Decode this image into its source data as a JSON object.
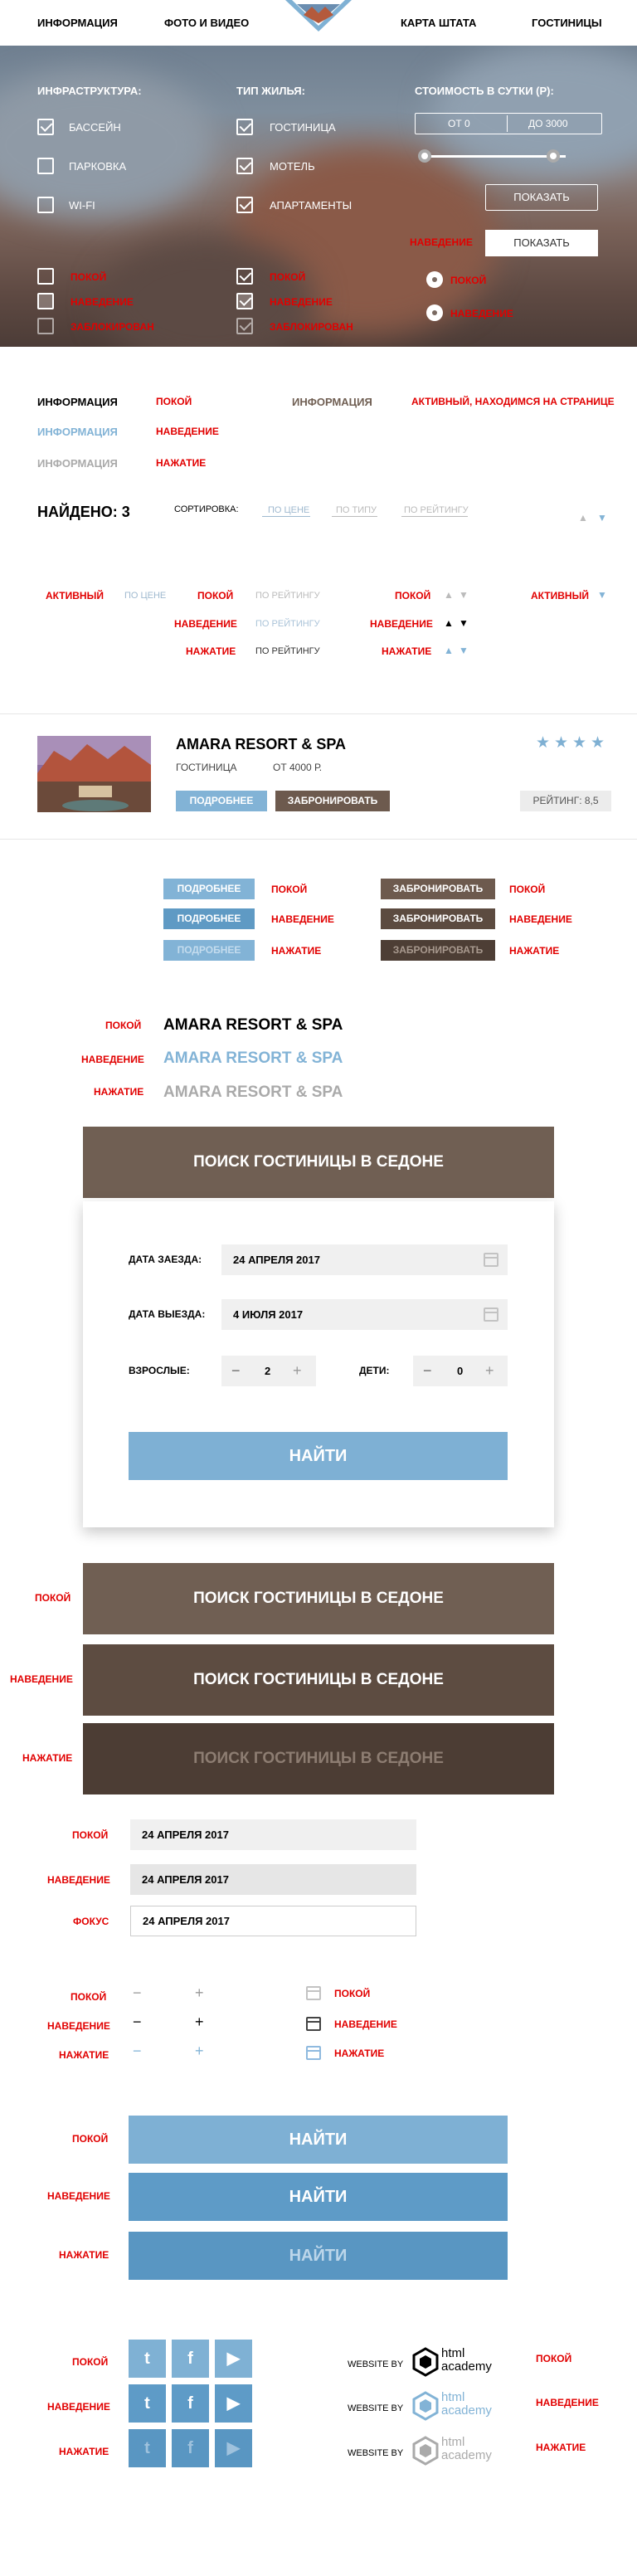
{
  "nav": {
    "info": "ИНФОРМАЦИЯ",
    "photo": "ФОТО И ВИДЕО",
    "map": "КАРТА ШТАТА",
    "hotels": "ГОСТИНИЦЫ",
    "logo": "SEDONA"
  },
  "hero": {
    "infra_title": "ИНФРАСТРУКТУРА:",
    "infra": [
      "БАССЕЙН",
      "ПАРКОВКА",
      "WI-FI"
    ],
    "type_title": "ТИП ЖИЛЬЯ:",
    "types": [
      "ГОСТИНИЦА",
      "МОТЕЛЬ",
      "АПАРТАМЕНТЫ"
    ],
    "price_title": "СТОИМОСТЬ В СУТКИ (Р):",
    "price_from": "ОТ 0",
    "price_to": "ДО 3000",
    "show": "ПОКАЗАТЬ",
    "hover": "НАВЕДЕНИЕ",
    "states": [
      "ПОКОЙ",
      "НАВЕДЕНИЕ",
      "ЗАБЛОКИРОВАН"
    ],
    "radio_states": [
      "ПОКОЙ",
      "НАВЕДЕНИЕ"
    ]
  },
  "states": {
    "rest": "ПОКОЙ",
    "hover": "НАВЕДЕНИЕ",
    "press": "НАЖАТИЕ",
    "active": "АКТИВНЫЙ",
    "focus": "ФОКУС",
    "active_page": "АКТИВНЫЙ, НАХОДИМСЯ НА СТРАНИЦЕ",
    "info": "ИНФОРМАЦИЯ"
  },
  "results": {
    "found": "НАЙДЕНО: 3",
    "sort_label": "СОРТИРОВКА:",
    "by_price": "ПО ЦЕНЕ",
    "by_type": "ПО ТИПУ",
    "by_rating": "ПО РЕЙТИНГУ"
  },
  "hotel": {
    "name": "AMARA RESORT & SPA",
    "type": "ГОСТИНИЦА",
    "price": "ОТ 4000 Р.",
    "more": "ПОДРОБНЕЕ",
    "book": "ЗАБРОНИРОВАТЬ",
    "rating": "РЕЙТИНГ: 8,5",
    "stars": 4
  },
  "search": {
    "title": "ПОИСК ГОСТИНИЦЫ В СЕДОНЕ",
    "checkin_label": "ДАТА ЗАЕЗДА:",
    "checkin": "24 АПРЕЛЯ 2017",
    "checkout_label": "ДАТА ВЫЕЗДА:",
    "checkout": "4 ИЮЛЯ 2017",
    "adults_label": "ВЗРОСЛЫЕ:",
    "adults": "2",
    "kids_label": "ДЕТИ:",
    "kids": "0",
    "find": "НАЙТИ",
    "minus": "−",
    "plus": "+"
  },
  "footer": {
    "website_by": "WEBSITE BY",
    "academy1": "html",
    "academy2": "academy"
  },
  "colors": {
    "blue": "#82b3d6",
    "brown": "#705f53",
    "red": "#e10000"
  }
}
